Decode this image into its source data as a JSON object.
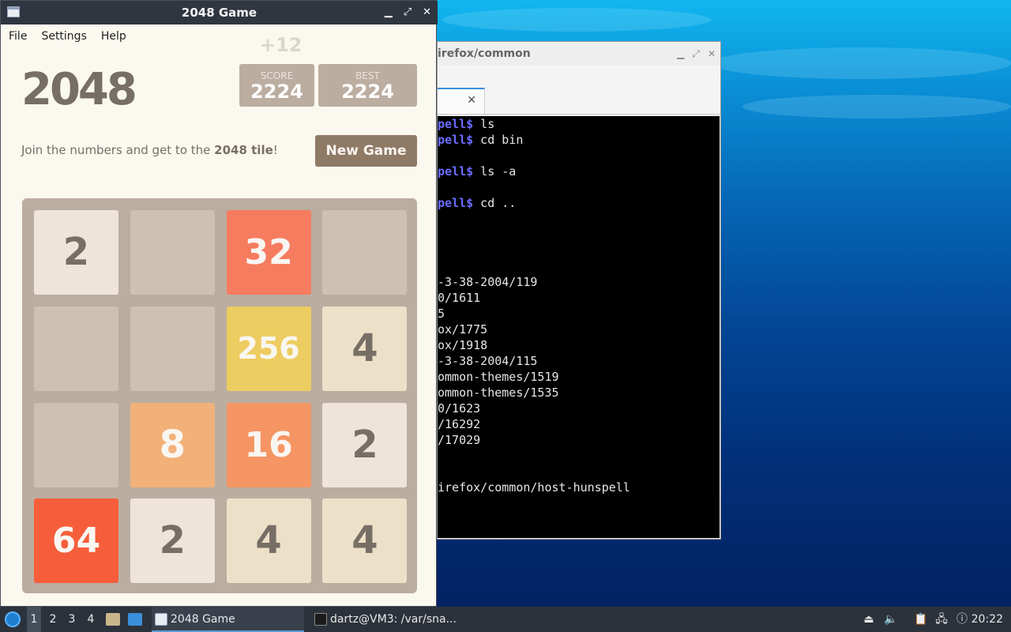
{
  "game_window": {
    "title": "2048 Game",
    "controls": {
      "minimize": "▁",
      "maximize": "⤢",
      "close": "✕"
    },
    "menu": [
      "File",
      "Settings",
      "Help"
    ],
    "logo": "2048",
    "score_increment": "+12",
    "score_label": "SCORE",
    "score_value": "2224",
    "best_label": "BEST",
    "best_value": "2224",
    "intro_prefix": "Join the numbers and get to the ",
    "intro_bold": "2048 tile",
    "intro_suffix": "!",
    "new_game_label": "New Game",
    "board": [
      [
        2,
        0,
        32,
        0
      ],
      [
        0,
        0,
        256,
        4
      ],
      [
        0,
        8,
        16,
        2
      ],
      [
        64,
        2,
        4,
        4
      ]
    ]
  },
  "terminal_window": {
    "title": "irefox/common",
    "controls": {
      "minimize": "▁",
      "maximize": "⤢",
      "close": "✕"
    },
    "tab_close": "✕",
    "lines": [
      {
        "prompt": "pell$",
        "text": " ls"
      },
      {
        "prompt": "pell$",
        "text": " cd bin"
      },
      {
        "prompt": "",
        "text": ""
      },
      {
        "prompt": "pell$",
        "text": " ls -a"
      },
      {
        "prompt": "",
        "text": ""
      },
      {
        "prompt": "pell$",
        "text": " cd .."
      },
      {
        "prompt": "",
        "text": ""
      },
      {
        "prompt": "",
        "text": ""
      },
      {
        "prompt": "",
        "text": ""
      },
      {
        "prompt": "",
        "text": ""
      },
      {
        "prompt": "",
        "text": "-3-38-2004/119"
      },
      {
        "prompt": "",
        "text": "0/1611"
      },
      {
        "prompt": "",
        "text": "5"
      },
      {
        "prompt": "",
        "text": "ox/1775"
      },
      {
        "prompt": "",
        "text": "ox/1918"
      },
      {
        "prompt": "",
        "text": "-3-38-2004/115"
      },
      {
        "prompt": "",
        "text": "ommon-themes/1519"
      },
      {
        "prompt": "",
        "text": "ommon-themes/1535"
      },
      {
        "prompt": "",
        "text": "0/1623"
      },
      {
        "prompt": "",
        "text": "/16292"
      },
      {
        "prompt": "",
        "text": "/17029"
      },
      {
        "prompt": "",
        "text": ""
      },
      {
        "prompt": "",
        "text": ""
      },
      {
        "prompt": "",
        "text": "irefox/common/host-hunspell"
      }
    ]
  },
  "taskbar": {
    "desktops": [
      "1",
      "2",
      "3",
      "4"
    ],
    "tasks": [
      {
        "label": "2048 Game",
        "icon": "window-icon",
        "active": true
      },
      {
        "label": "dartz@VM3: /var/sna...",
        "icon": "terminal-icon",
        "active": false
      }
    ],
    "tray": [
      "eject-icon",
      "volume-icon",
      "clipboard-icon",
      "network-icon",
      "update-icon"
    ],
    "clock": "20:22"
  }
}
